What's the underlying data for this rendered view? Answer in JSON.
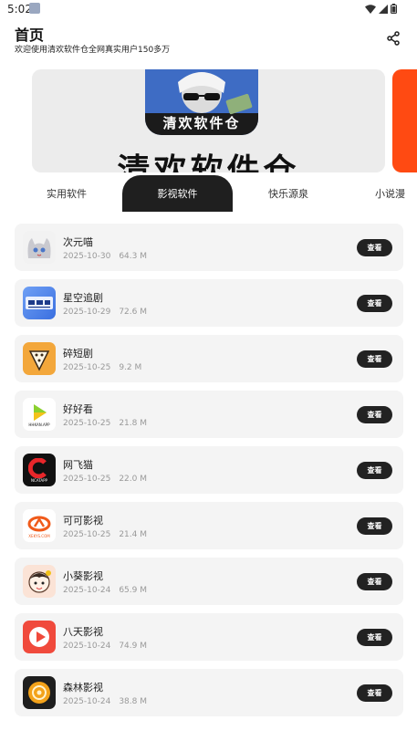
{
  "status_bar": {
    "time": "5:02"
  },
  "header": {
    "title": "首页",
    "subtitle": "欢迎使用清欢软件仓全网真实用户150多万"
  },
  "banner": {
    "art_text": "清欢软件仓",
    "title": "清欢软件仓"
  },
  "tabs": [
    {
      "label": "实用软件",
      "active": false
    },
    {
      "label": "影视软件",
      "active": true
    },
    {
      "label": "快乐源泉",
      "active": false
    },
    {
      "label": "小说漫",
      "active": false
    }
  ],
  "items": [
    {
      "name": "次元喵",
      "date": "2025-10-30",
      "size": "64.3 M",
      "button": "查看",
      "icon": "anime-cat-icon",
      "icon_color": "#f2f2f2"
    },
    {
      "name": "星空追剧",
      "date": "2025-10-29",
      "size": "72.6 M",
      "button": "查看",
      "icon": "starry-drama-icon",
      "icon_color": "#3a6fe0"
    },
    {
      "name": "碎短剧",
      "date": "2025-10-25",
      "size": "9.2 M",
      "button": "查看",
      "icon": "film-slice-icon",
      "icon_color": "#f3a73b"
    },
    {
      "name": "好好看",
      "date": "2025-10-25",
      "size": "21.8 M",
      "button": "查看",
      "icon": "play-arrow-icon",
      "icon_color": "#ffffff",
      "icon_label": "HHKAN.APP"
    },
    {
      "name": "网飞猫",
      "date": "2025-10-25",
      "size": "22.0 M",
      "button": "查看",
      "icon": "ncat-logo-icon",
      "icon_color": "#111111",
      "icon_label": "NCATAPP"
    },
    {
      "name": "可可影视",
      "date": "2025-10-25",
      "size": "21.4 M",
      "button": "查看",
      "icon": "keke-logo-icon",
      "icon_color": "#ffffff",
      "icon_label": "XEKYS.COM"
    },
    {
      "name": "小葵影视",
      "date": "2025-10-24",
      "size": "65.9 M",
      "button": "查看",
      "icon": "cartoon-girl-icon",
      "icon_color": "#fbe3d6"
    },
    {
      "name": "八天影视",
      "date": "2025-10-24",
      "size": "74.9 M",
      "button": "查看",
      "icon": "red-play-icon",
      "icon_color": "#f04a3c"
    },
    {
      "name": "森林影视",
      "date": "2025-10-24",
      "size": "38.8 M",
      "button": "查看",
      "icon": "forest-logo-icon",
      "icon_color": "#1e1e1e"
    }
  ]
}
